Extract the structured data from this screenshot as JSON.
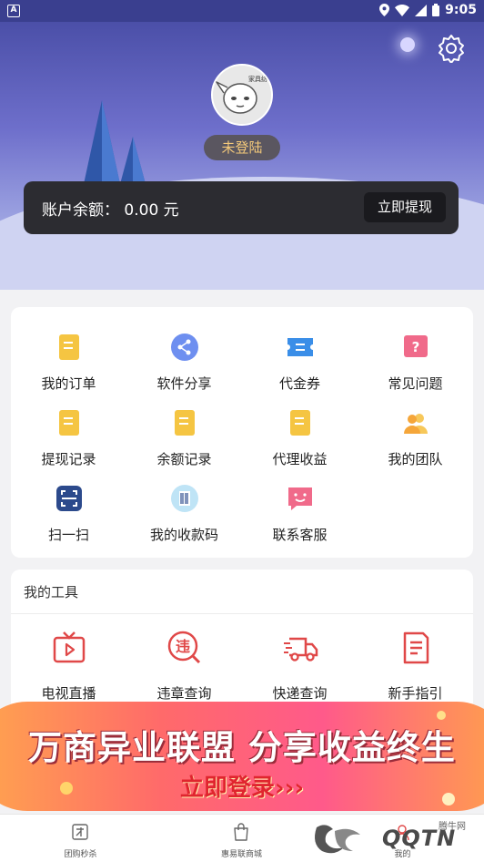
{
  "status_bar": {
    "time": "9:05"
  },
  "profile": {
    "avatar_tag": "家具纺",
    "login_label": "未登陆",
    "balance_label": "账户余额：",
    "balance_value": "0.00 元",
    "withdraw_label": "立即提现"
  },
  "menu": [
    {
      "label": "我的订单",
      "icon": "order-icon",
      "color": "#f5c542"
    },
    {
      "label": "软件分享",
      "icon": "share-icon",
      "color": "#6e8ff0"
    },
    {
      "label": "代金券",
      "icon": "voucher-icon",
      "color": "#3a8ee8"
    },
    {
      "label": "常见问题",
      "icon": "question-icon",
      "color": "#f06a8a"
    },
    {
      "label": "提现记录",
      "icon": "withdraw-record-icon",
      "color": "#f5c542"
    },
    {
      "label": "余额记录",
      "icon": "balance-record-icon",
      "color": "#f5c542"
    },
    {
      "label": "代理收益",
      "icon": "agent-income-icon",
      "color": "#f5c542"
    },
    {
      "label": "我的团队",
      "icon": "team-icon",
      "color": "#f5b342"
    },
    {
      "label": "扫一扫",
      "icon": "scan-icon",
      "color": "#2c4a8c"
    },
    {
      "label": "我的收款码",
      "icon": "payment-code-icon",
      "color": "#5ab0e0"
    },
    {
      "label": "联系客服",
      "icon": "customer-service-icon",
      "color": "#f06a8a"
    }
  ],
  "tools": {
    "title": "我的工具",
    "items": [
      {
        "label": "电视直播",
        "icon": "tv-icon"
      },
      {
        "label": "违章查询",
        "icon": "violation-icon"
      },
      {
        "label": "快递查询",
        "icon": "delivery-icon"
      },
      {
        "label": "新手指引",
        "icon": "guide-icon"
      }
    ],
    "accent": "#e04848"
  },
  "banner": {
    "title": "万商异业联盟 分享收益终生",
    "subtitle": "立即登录›››"
  },
  "tabbar": [
    {
      "label": "团购秒杀",
      "icon": "group-buy-icon"
    },
    {
      "label": "惠易联商城",
      "icon": "shopping-bag-icon"
    },
    {
      "label": "我的",
      "icon": "profile-icon"
    }
  ],
  "watermark": {
    "text": "QQTN",
    "small": "腾牛网"
  }
}
